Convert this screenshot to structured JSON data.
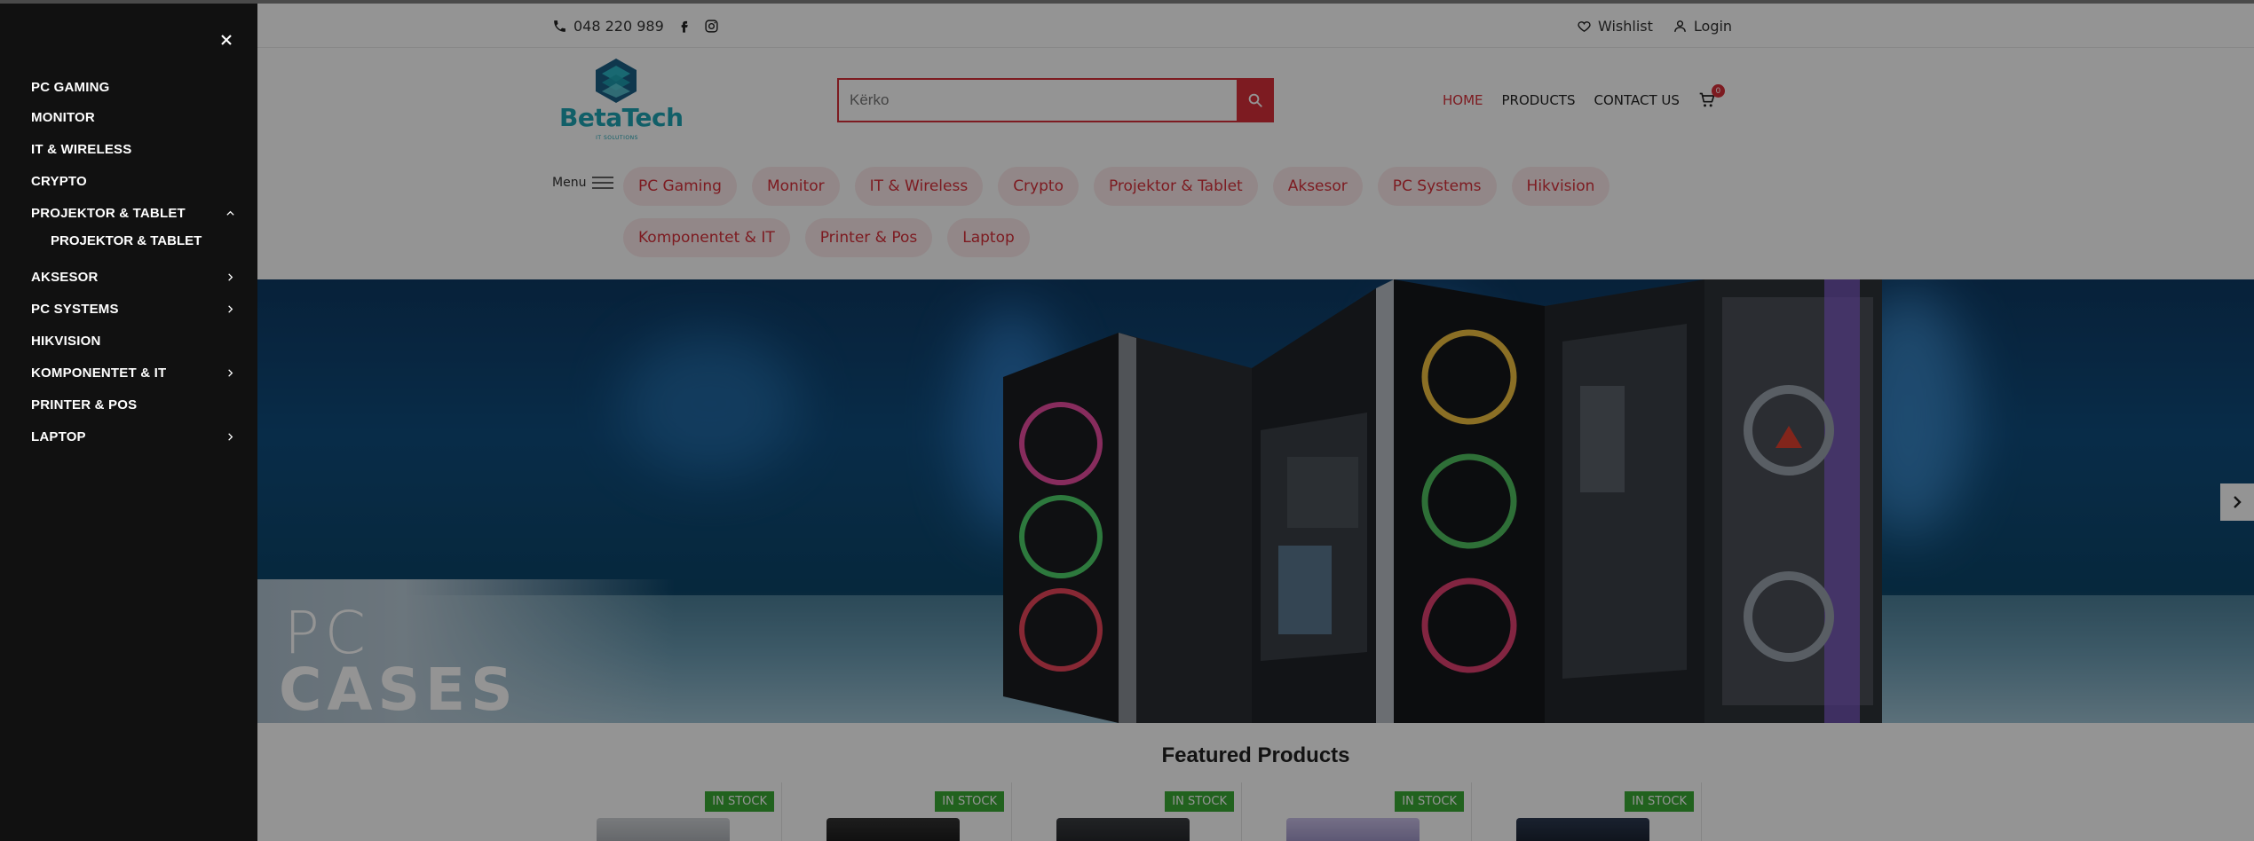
{
  "topbar": {
    "phone": "048 220 989",
    "wishlist_label": "Wishlist",
    "login_label": "Login"
  },
  "brand": {
    "name": "BetaTech",
    "tagline": "IT SOLUTIONS",
    "color": "#1ea4b4"
  },
  "search": {
    "placeholder": "Kërko",
    "accent": "#d8303a"
  },
  "nav": {
    "home": "HOME",
    "products": "PRODUCTS",
    "contact": "CONTACT US",
    "cart_count": "0"
  },
  "category_bar": {
    "menu_label": "Menu",
    "chips": [
      "PC Gaming",
      "Monitor",
      "IT & Wireless",
      "Crypto",
      "Projektor & Tablet",
      "Aksesor",
      "PC Systems",
      "Hikvision",
      "Komponentet & IT",
      "Printer & Pos",
      "Laptop"
    ]
  },
  "hero": {
    "line1": "PC",
    "line2": "CASES"
  },
  "featured": {
    "title": "Featured Products",
    "badges": [
      "IN STOCK",
      "IN STOCK",
      "IN STOCK",
      "IN STOCK",
      "IN STOCK"
    ]
  },
  "drawer": {
    "items": [
      {
        "label": "PC GAMING"
      },
      {
        "label": "MONITOR"
      },
      {
        "label": "IT & WIRELESS"
      },
      {
        "label": "CRYPTO"
      },
      {
        "label": "PROJEKTOR & TABLET",
        "expanded": true,
        "children": [
          "PROJEKTOR & TABLET"
        ]
      },
      {
        "label": "AKSESOR",
        "has_children": true
      },
      {
        "label": "PC SYSTEMS",
        "has_children": true
      },
      {
        "label": "HIKVISION"
      },
      {
        "label": "KOMPONENTET & IT",
        "has_children": true
      },
      {
        "label": "PRINTER & POS"
      },
      {
        "label": "LAPTOP",
        "has_children": true
      }
    ]
  }
}
